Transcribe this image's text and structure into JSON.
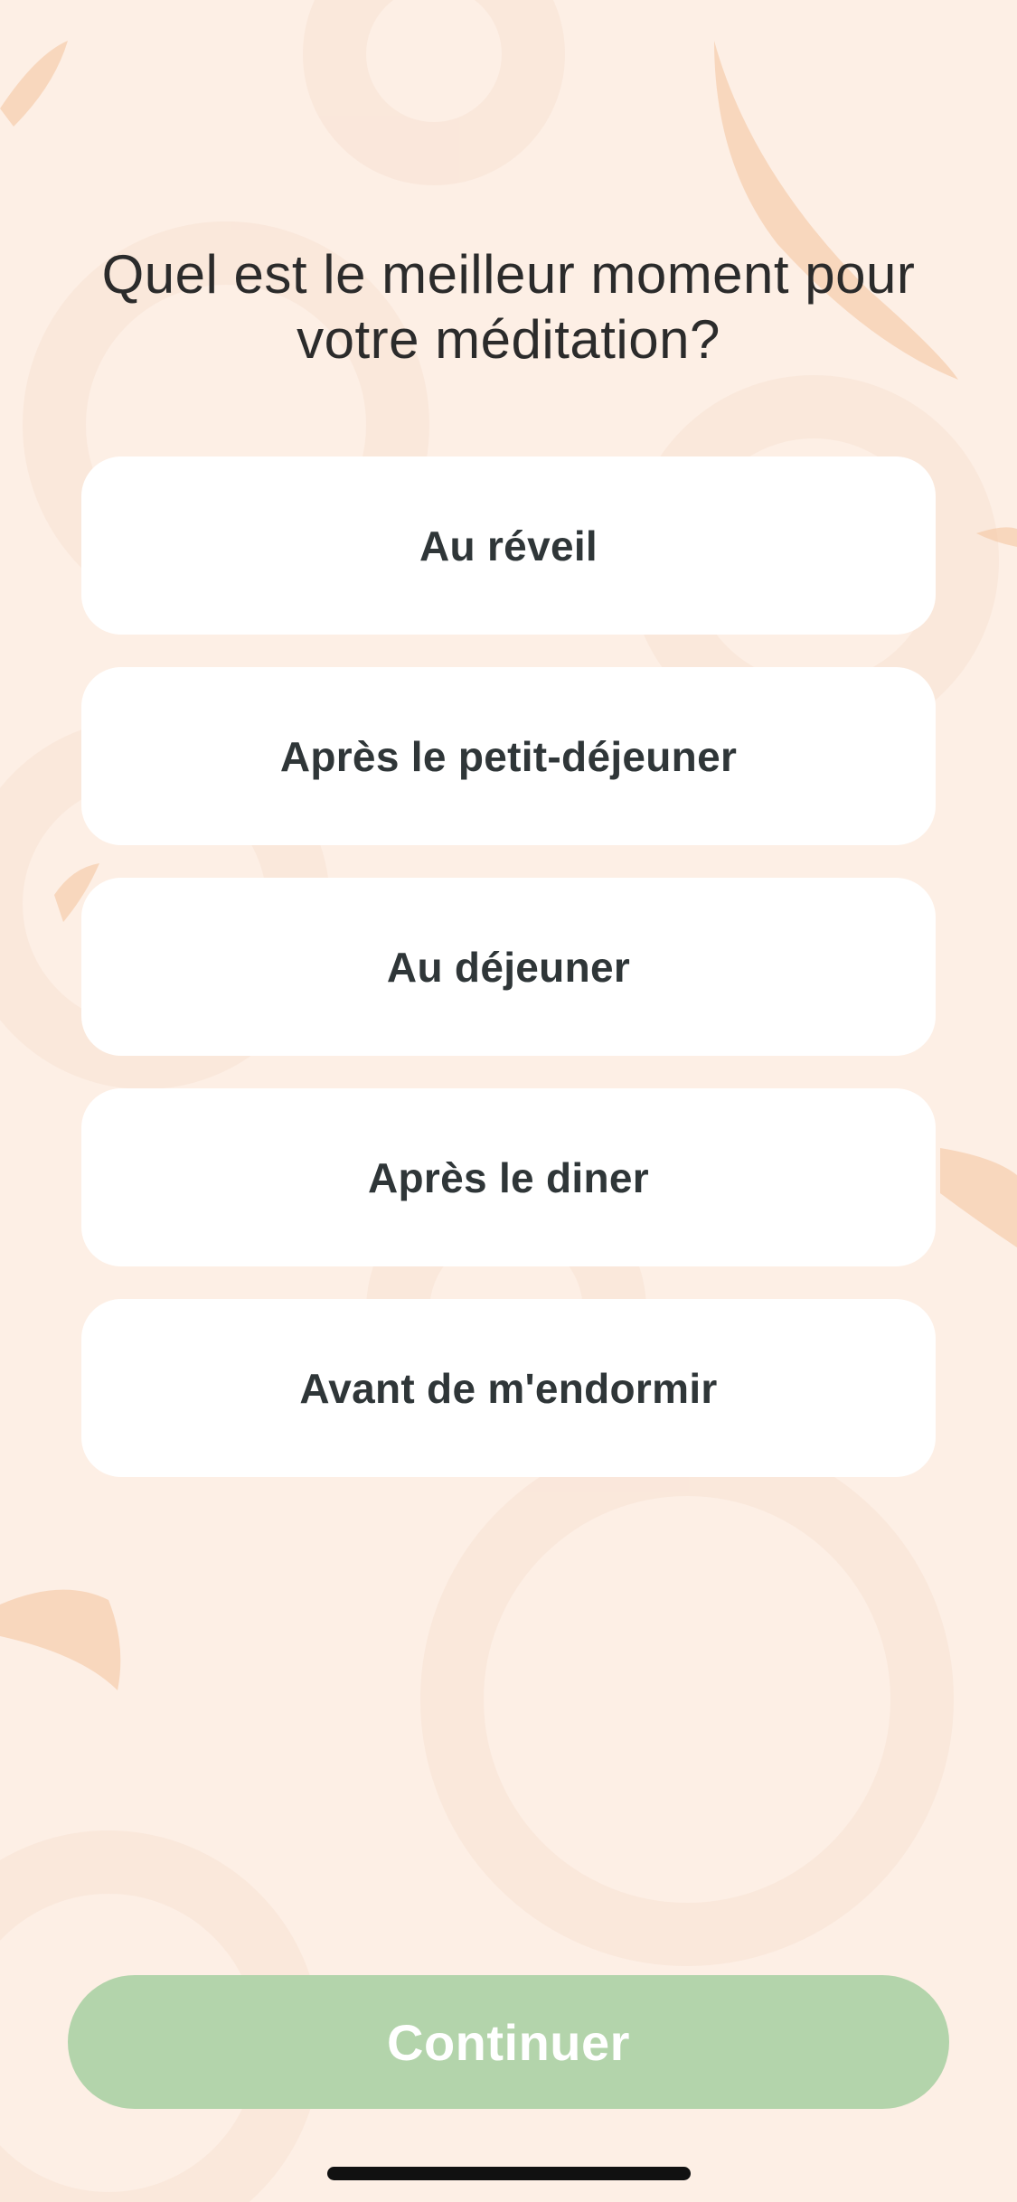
{
  "question": {
    "title_line1": "Quel est le meilleur moment pour",
    "title_line2": "votre méditation?"
  },
  "options": [
    {
      "label": "Au réveil"
    },
    {
      "label": "Après le petit-déjeuner"
    },
    {
      "label": "Au déjeuner"
    },
    {
      "label": "Après le diner"
    },
    {
      "label": "Avant de m'endormir"
    }
  ],
  "footer": {
    "continue_label": "Continuer"
  },
  "colors": {
    "background": "#fdefe5",
    "option_background": "#ffffff",
    "continue_button": "#b3d4ab",
    "decoration": "#f6c8a0"
  }
}
